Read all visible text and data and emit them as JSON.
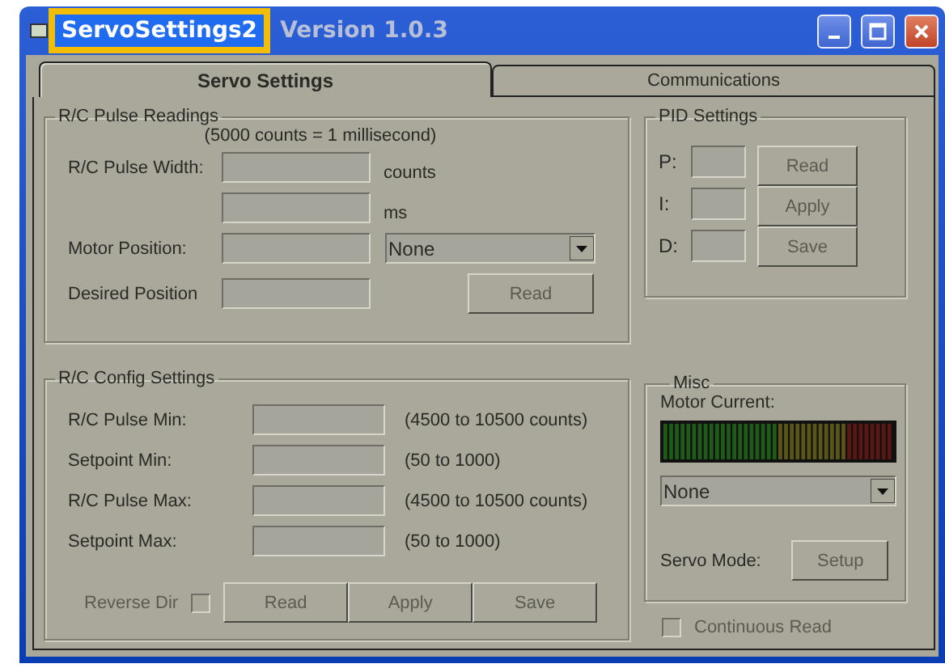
{
  "window": {
    "title": "ServoSettings2",
    "version": "Version 1.0.3",
    "highlighted": true
  },
  "tabs": [
    {
      "label": "Servo Settings",
      "selected": true
    },
    {
      "label": "Communications",
      "selected": false
    }
  ],
  "pulse_readings": {
    "title": "R/C Pulse Readings",
    "note": "(5000 counts = 1 millisecond)",
    "pulse_width": {
      "label": "R/C Pulse Width:",
      "unit_counts": "counts",
      "unit_ms": "ms"
    },
    "motor_position": {
      "label": "Motor Position:"
    },
    "desired_position": {
      "label": "Desired Position"
    },
    "dropdown": {
      "value": "None"
    },
    "read_button": {
      "label": "Read",
      "disabled": true
    }
  },
  "pid_settings": {
    "title": "PID Settings",
    "fields": [
      {
        "label": "P:"
      },
      {
        "label": "I:"
      },
      {
        "label": "D:"
      }
    ],
    "buttons": [
      {
        "label": "Read",
        "disabled": true
      },
      {
        "label": "Apply",
        "disabled": true
      },
      {
        "label": "Save",
        "disabled": true
      }
    ]
  },
  "config_settings": {
    "title": "R/C Config Settings",
    "rows": [
      {
        "label": "R/C Pulse Min:",
        "range": "(4500 to 10500 counts)"
      },
      {
        "label": "Setpoint Min:",
        "range": "(50 to 1000)"
      },
      {
        "label": "R/C Pulse Max:",
        "range": "(4500 to 10500 counts)"
      },
      {
        "label": "Setpoint Max:",
        "range": "(50 to 1000)"
      }
    ],
    "reverse_dir": {
      "label": "Reverse Dir",
      "checked": false,
      "disabled": true
    },
    "buttons": [
      {
        "label": "Read",
        "disabled": true
      },
      {
        "label": "Apply",
        "disabled": true
      },
      {
        "label": "Save",
        "disabled": true
      }
    ]
  },
  "misc": {
    "title": "Misc",
    "motor_current": {
      "label": "Motor Current:"
    },
    "dropdown": {
      "value": "None"
    },
    "servo_mode": {
      "label": "Servo Mode:",
      "button": {
        "label": "Setup",
        "disabled": true
      }
    }
  },
  "continuous_read": {
    "label": "Continuous Read",
    "checked": false,
    "disabled": true
  }
}
